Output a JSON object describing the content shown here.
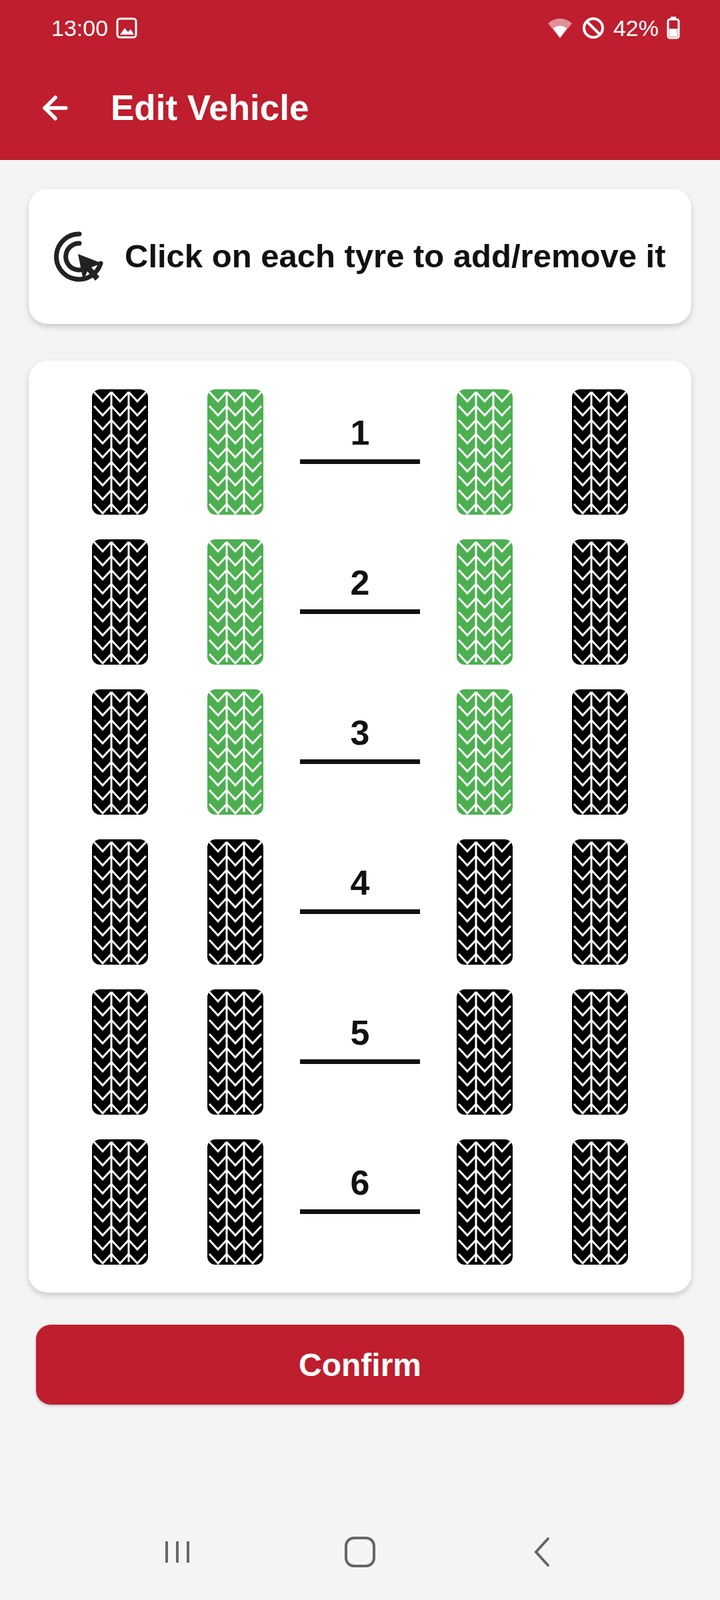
{
  "status_bar": {
    "time": "13:00",
    "battery": "42%"
  },
  "app_bar": {
    "title": "Edit Vehicle"
  },
  "hint": {
    "text": "Click on each tyre to add/remove it"
  },
  "axles": [
    {
      "number": "1",
      "tyres": [
        {
          "selected": false
        },
        {
          "selected": true
        },
        {
          "selected": true
        },
        {
          "selected": false
        }
      ]
    },
    {
      "number": "2",
      "tyres": [
        {
          "selected": false
        },
        {
          "selected": true
        },
        {
          "selected": true
        },
        {
          "selected": false
        }
      ]
    },
    {
      "number": "3",
      "tyres": [
        {
          "selected": false
        },
        {
          "selected": true
        },
        {
          "selected": true
        },
        {
          "selected": false
        }
      ]
    },
    {
      "number": "4",
      "tyres": [
        {
          "selected": false
        },
        {
          "selected": false
        },
        {
          "selected": false
        },
        {
          "selected": false
        }
      ]
    },
    {
      "number": "5",
      "tyres": [
        {
          "selected": false
        },
        {
          "selected": false
        },
        {
          "selected": false
        },
        {
          "selected": false
        }
      ]
    },
    {
      "number": "6",
      "tyres": [
        {
          "selected": false
        },
        {
          "selected": false
        },
        {
          "selected": false
        },
        {
          "selected": false
        }
      ]
    }
  ],
  "buttons": [
    "Confirm"
  ]
}
